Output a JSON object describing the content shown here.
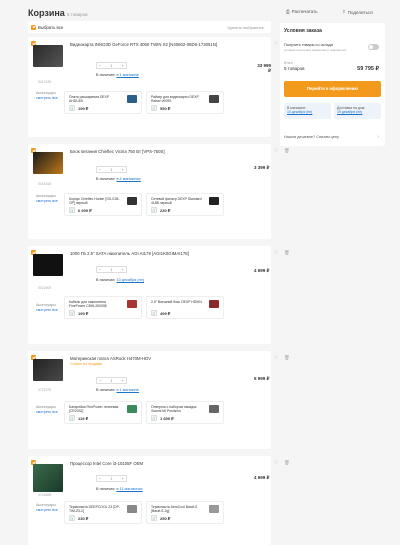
{
  "page": {
    "title": "Корзина",
    "count": "5 товаров"
  },
  "header": {
    "print": "Распечатать",
    "share": "Поделиться"
  },
  "select_bar": {
    "select_all": "Выбрать все",
    "delete_selected": "Удалить выбранное"
  },
  "labels": {
    "accessories": "Аксессуары",
    "see_all": "смотреть все",
    "in_stock": "В наличии:"
  },
  "colors": {
    "accent": "#f39a1d",
    "link": "#1a73c8"
  },
  "items": [
    {
      "name": "Видеокарта INNO3D GeForce RTX 4060 TWIN X2 [N40602-08D6-173051N]",
      "code": "5417435",
      "qty": "1",
      "availability": "в 1 магазине",
      "price": "33 999 ₽",
      "accessories": [
        {
          "name": "Плата расширения DEXP AHDU1B",
          "price": "199 ₽"
        },
        {
          "name": "Райзер для видеокарты DEXP Raiser v009S",
          "price": "550 ₽"
        }
      ]
    },
    {
      "name": "Блок питания Chieftec Vicina 750 Вт [VPS-750S]",
      "code": "5161468",
      "qty": "1",
      "availability": "в 4 магазинах",
      "price": "3 399 ₽",
      "accessories": [
        {
          "name": "Корпус Chieftec Hunter [GS-01B-OP] черный",
          "price": "6 699 ₽"
        },
        {
          "name": "Сетевой фильтр DEXP Standard 418B черный",
          "price": "230 ₽"
        }
      ]
    },
    {
      "name": "1000 ГБ 2.5\" SATA накопитель AGI AI178 [AGI1K0GIMAI178]",
      "code": "5021905",
      "qty": "1",
      "availability": "10 декабря (пн)",
      "price": "4 699 ₽",
      "accessories": [
        {
          "name": "Кабель для накопителя FinePower CBHL260008",
          "price": "199 ₽"
        },
        {
          "name": "2.5\" Внешний бокс DEXP HD504",
          "price": "499 ₽"
        }
      ]
    },
    {
      "name": "Материнская плата ASRock H470M-HDV",
      "sub": "Снятое из продажи",
      "code": "4721975",
      "qty": "1",
      "availability": "в 1 магазине",
      "price": "6 999 ₽",
      "accessories": [
        {
          "name": "Батарейка FinePower литиевая [CR2032]",
          "price": "119 ₽"
        },
        {
          "name": "Отвертка с набором насадок Xiaomi Mi Precision",
          "price": "1 699 ₽"
        }
      ]
    },
    {
      "name": "Процессор Intel Core i3-10105F OEM",
      "code": "4724888",
      "qty": "1",
      "availability": "в 11 магазинах",
      "price": "4 699 ₽",
      "accessories": [
        {
          "name": "Термопаста DEEPCOOL Z3 [DP-TIM-Z3-2]",
          "price": "230 ₽"
        },
        {
          "name": "Термопаста AeroCool Baraf-S [Baraf-S-2g]",
          "price": "250 ₽"
        }
      ]
    }
  ],
  "summary": {
    "title": "Условия заказа",
    "pickup": "Получить товары со склада",
    "pickup_note": "условия получения заказа могут измениться",
    "total_label": "Итого:",
    "total_items": "5 товаров",
    "total_price": "59 795 ₽",
    "order_button": "Перейти к оформлению",
    "store_label": "В магазине:",
    "store_date": "10 декабря (пн)",
    "home_label": "Доставка на дом:",
    "home_date": "19 декабря (пн)",
    "cheaper": "Нашли дешевле? Снизим цену"
  }
}
